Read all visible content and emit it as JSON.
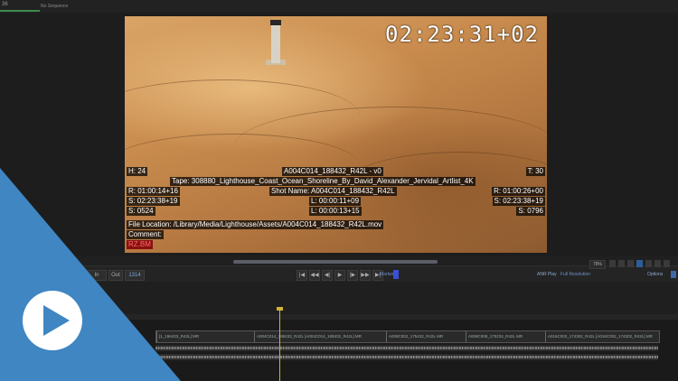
{
  "topbar": {
    "timestamp": "36",
    "sequence": "No Sequence"
  },
  "viewer": {
    "timecode": "02:23:31+02",
    "overlay": {
      "handles": "H: 24",
      "clip_name": "A004C014_188432_R42L - v0",
      "tracks": "T: 30",
      "tape": "Tape: 308880_Lighthouse_Coast_Ocean_Shoreline_By_David_Alexander_Jervidal_Artlist_4K",
      "rec_in": "R: 01:00:14+16",
      "shot_name": "Shot Name: A004C014_188432_R42L",
      "rec_out": "R: 01:00:26+00",
      "src_in": "S: 02:23:38+19",
      "length_a": "L: 00:00:11+09",
      "src_out": "S: 02:23:38+19",
      "frame_a": "S: 0524",
      "length_b": "L: 00:00:13+15",
      "frame_b": "S: 0796",
      "file_location": "File Location: /Library/Media/Lighthouse/Assets/A004C014_188432_R42L.mov",
      "comment": "Comment:",
      "tag": "RZ.BM"
    }
  },
  "transport": {
    "in_label": "In",
    "out_label": "Out",
    "duration": "1314",
    "marker_label": "Marker",
    "right_chip_a": "ANR Play",
    "right_chip_b": "Full Resolution",
    "options_label": "Options",
    "zoom": "78%"
  },
  "timeline": {
    "clips": [
      {
        "label": "[1_196433_R42L] MR"
      },
      {
        "label": "A004C014_188432_R42L [A004C014_188432_R42L] MR"
      },
      {
        "label": "A009C002_175432_R42L MR"
      },
      {
        "label": "A009C008_175234_R42L MR"
      },
      {
        "label": "A016C002_174302_R42L [A016C002_174302_R42L] MR"
      }
    ]
  },
  "colors": {
    "accent_blue": "#4a90c8",
    "playhead": "#d4b23a",
    "marker": "#3a4fd8"
  }
}
